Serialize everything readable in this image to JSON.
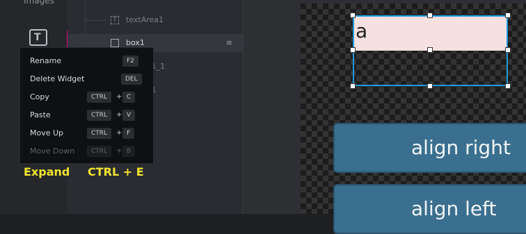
{
  "rail": {
    "section_label": "Images",
    "icon": "text-widget-icon"
  },
  "tree": {
    "items": [
      {
        "label": "textArea1",
        "icon": "text-area-icon"
      },
      {
        "label": "box1",
        "icon": "box-icon",
        "selected": true,
        "drag_icon": "drag-handle-icon"
      },
      {
        "label": "nLabel1_1",
        "icon": "label-icon"
      },
      {
        "label": "nLabel1",
        "icon": "label-icon"
      }
    ]
  },
  "context_menu": {
    "items": [
      {
        "label": "Rename",
        "keys": [
          "F2"
        ],
        "enabled": true
      },
      {
        "label": "Delete Widget",
        "keys": [
          "DEL"
        ],
        "enabled": true
      },
      {
        "label": "Copy",
        "keys": [
          "CTRL",
          "C"
        ],
        "enabled": true
      },
      {
        "label": "Paste",
        "keys": [
          "CTRL",
          "V"
        ],
        "enabled": true
      },
      {
        "label": "Move Up",
        "keys": [
          "CTRL",
          "F"
        ],
        "enabled": true
      },
      {
        "label": "Move Down",
        "keys": [
          "CTRL",
          "B"
        ],
        "enabled": false
      }
    ],
    "plus": "+"
  },
  "captions": {
    "left": "Expand",
    "right": "CTRL + E"
  },
  "canvas": {
    "text_area_value": "a",
    "buttons": [
      "align right",
      "align left"
    ]
  },
  "colors": {
    "selection_outline": "#1e9be0",
    "tree_accent": "#e0007a",
    "caption": "#f3e430",
    "canvas_button": "#3a6f8f"
  }
}
